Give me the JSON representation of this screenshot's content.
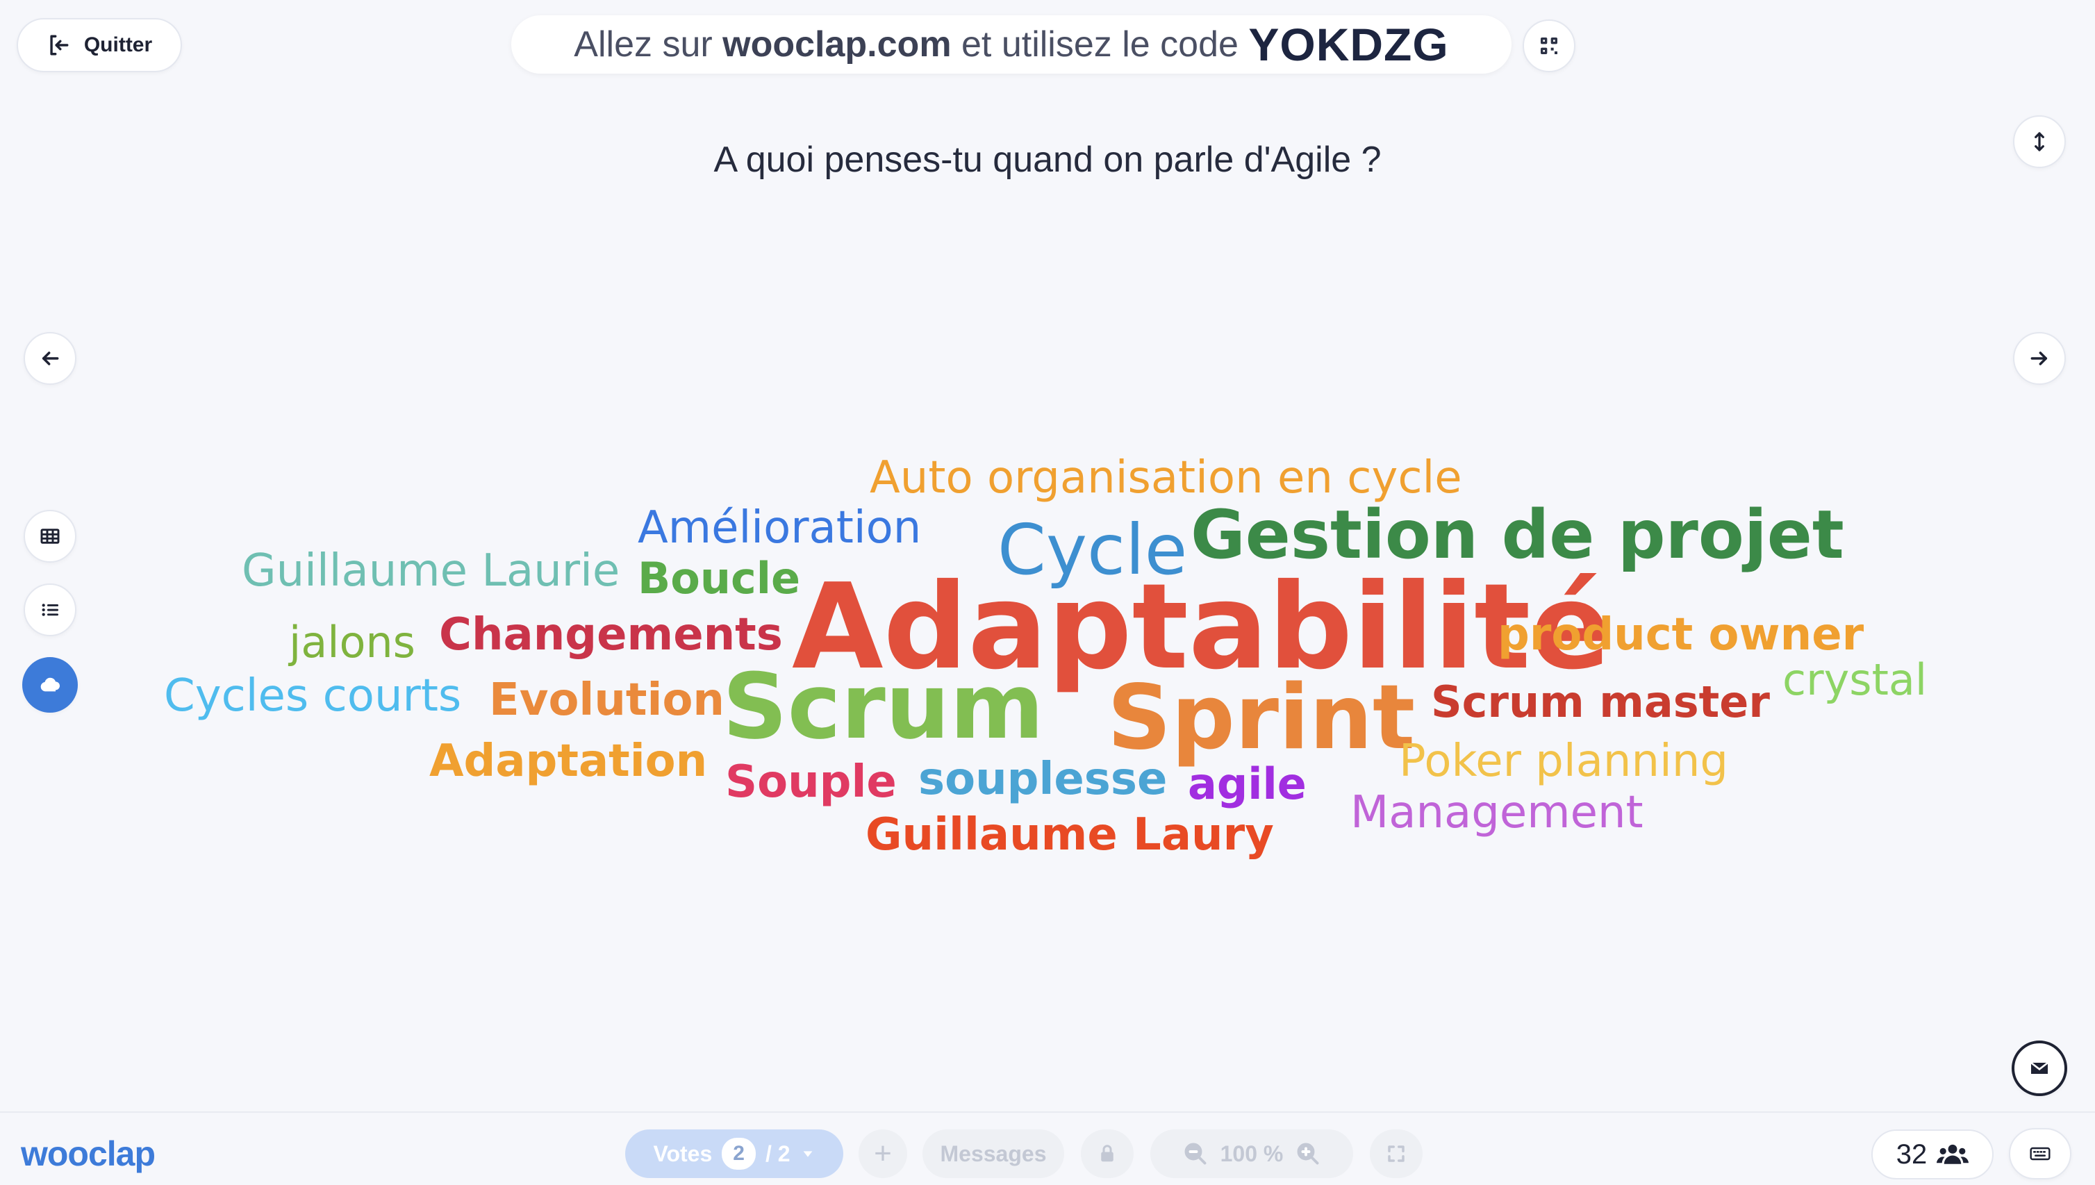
{
  "header": {
    "quit_label": "Quitter",
    "join_prefix": "Allez sur",
    "join_site": "wooclap.com",
    "join_middle": "et utilisez le code",
    "join_code": "YOKDZG"
  },
  "question": "A quoi penses-tu quand on parle d'Agile ?",
  "wordcloud": [
    {
      "text": "Auto organisation en cycle",
      "color": "#f0a030"
    },
    {
      "text": "Amélioration",
      "color": "#3a78e0"
    },
    {
      "text": "Cycle",
      "color": "#3d8fd0"
    },
    {
      "text": "Gestion de projet",
      "color": "#3c8a48"
    },
    {
      "text": "Guillaume Laurie",
      "color": "#6fbfb2"
    },
    {
      "text": "Boucle",
      "color": "#5aab4a"
    },
    {
      "text": "Adaptabilité",
      "color": "#e1503c"
    },
    {
      "text": "jalons",
      "color": "#7fb33e"
    },
    {
      "text": "Changements",
      "color": "#c9344a"
    },
    {
      "text": "product owner",
      "color": "#f0a030"
    },
    {
      "text": "crystal",
      "color": "#8dd464"
    },
    {
      "text": "Cycles courts",
      "color": "#4fbcee"
    },
    {
      "text": "Evolution",
      "color": "#ea8a3c"
    },
    {
      "text": "Scrum",
      "color": "#82be52"
    },
    {
      "text": "Sprint",
      "color": "#e8863c"
    },
    {
      "text": "Scrum master",
      "color": "#c93c2f"
    },
    {
      "text": "Adaptation",
      "color": "#f0a030"
    },
    {
      "text": "Souple",
      "color": "#e03a62"
    },
    {
      "text": "souplesse",
      "color": "#4ba4d4"
    },
    {
      "text": "agile",
      "color": "#a12ee0"
    },
    {
      "text": "Poker planning",
      "color": "#f2c24a"
    },
    {
      "text": "Management",
      "color": "#c064d8"
    },
    {
      "text": "Guillaume Laury",
      "color": "#e84a24"
    }
  ],
  "footer": {
    "brand": "wooclap",
    "votes_label": "Votes",
    "votes_current": "2",
    "votes_total": "/ 2",
    "add_symbol": "+",
    "messages_label": "Messages",
    "zoom_value": "100 %",
    "participants_count": "32"
  },
  "icons": {
    "quit": "exit-icon",
    "qr": "qr-code-icon",
    "expand": "vertical-arrows-icon",
    "prev": "arrow-left-icon",
    "next": "arrow-right-icon",
    "grid": "table-grid-icon",
    "list": "list-icon",
    "cloud": "cloud-icon",
    "mail": "envelope-icon",
    "keyboard": "keyboard-icon",
    "people": "people-icon",
    "lock": "lock-icon",
    "zoom_out": "zoom-out-icon",
    "zoom_in": "zoom-in-icon",
    "fullscreen": "fullscreen-icon"
  },
  "colors": {
    "accent": "#3d7bd9",
    "cloud_button": "#3d7bd9"
  }
}
